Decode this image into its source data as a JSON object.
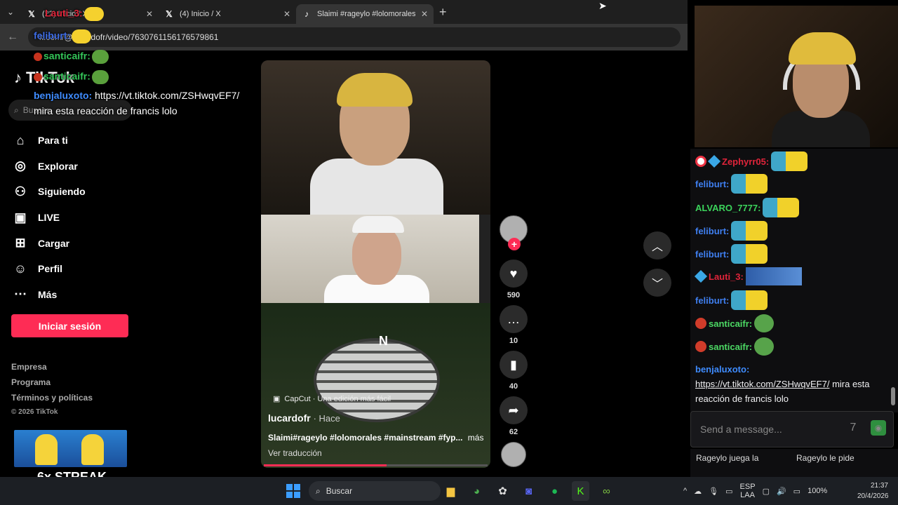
{
  "browser": {
    "tabs": [
      {
        "label": "(22) Inicio / X",
        "icon": "x-icon"
      },
      {
        "label": "(4) Inicio / X",
        "icon": "x-icon"
      },
      {
        "label": "Slaimi #rageylo #lolomorales",
        "icon": "tiktok-icon"
      }
    ],
    "url": "k.com/@lucardofr/video/7630761156176579861"
  },
  "tiktok": {
    "logo": "TikTok",
    "search_placeholder": "Buscar",
    "menu": [
      {
        "label": "Para ti",
        "icon": "home-icon"
      },
      {
        "label": "Explorar",
        "icon": "compass-icon"
      },
      {
        "label": "Siguiendo",
        "icon": "following-icon"
      },
      {
        "label": "LIVE",
        "icon": "live-icon"
      },
      {
        "label": "Cargar",
        "icon": "upload-icon"
      },
      {
        "label": "Perfil",
        "icon": "profile-icon"
      },
      {
        "label": "Más",
        "icon": "more-icon"
      }
    ],
    "login": "Iniciar sesión",
    "footer": [
      "Empresa",
      "Programa",
      "Términos y políticas",
      "© 2026 TikTok"
    ],
    "streak": "6x STREAK",
    "video": {
      "capcut": "CapCut · Una edición más fácil",
      "author": "lucardofr",
      "hace": "· Hace",
      "caption": "Slaimi#rageylo #lolomorales #mainstream #fyp...",
      "more": "más",
      "translate": "Ver traducción",
      "progress": 0.55
    },
    "actions": {
      "likes": "590",
      "comments": "10",
      "saves": "40",
      "shares": "62"
    }
  },
  "overlay": [
    {
      "user": "Lauti_3:",
      "color": "#e0243a"
    },
    {
      "user": "feliburt:",
      "color": "#3f6ee8"
    },
    {
      "user": "santicaifr:",
      "color": "#34c759"
    },
    {
      "user": "santicaifr:",
      "color": "#34c759"
    },
    {
      "user": "benjaluxoto:",
      "color": "#3f8cff",
      "text": "https://vt.tiktok.com/ZSHwqvEF7/"
    },
    {
      "text": "mira esta reacción de francis lolo"
    }
  ],
  "chat": {
    "messages": [
      {
        "user": "Zephyrr05:",
        "color": "#e0243a"
      },
      {
        "user": "feliburt:",
        "color": "#3f7ff0"
      },
      {
        "user": "ALVARO_7777:",
        "color": "#3bd35b"
      },
      {
        "user": "feliburt:",
        "color": "#3f7ff0"
      },
      {
        "user": "feliburt:",
        "color": "#3f7ff0"
      },
      {
        "user": "Lauti_3:",
        "color": "#e0243a"
      },
      {
        "user": "feliburt:",
        "color": "#3f7ff0"
      },
      {
        "user": "santicaifr:",
        "color": "#4cd964"
      },
      {
        "user": "santicaifr:",
        "color": "#4cd964"
      }
    ],
    "last_user": "benjaluxoto:",
    "last_user_color": "#3f8cff",
    "last_link": "https://vt.tiktok.com/ZSHwqvEF7/",
    "last_text": " mira esta reacción de francis lolo",
    "input_placeholder": "Send a message...",
    "below": [
      "Rageylo juega la",
      "Rageylo le pide"
    ]
  },
  "taskbar": {
    "search": "Buscar",
    "lang": "ESP",
    "lang2": "LAA",
    "battery": "100%",
    "time": "21:37",
    "date": "20/4/2026"
  }
}
